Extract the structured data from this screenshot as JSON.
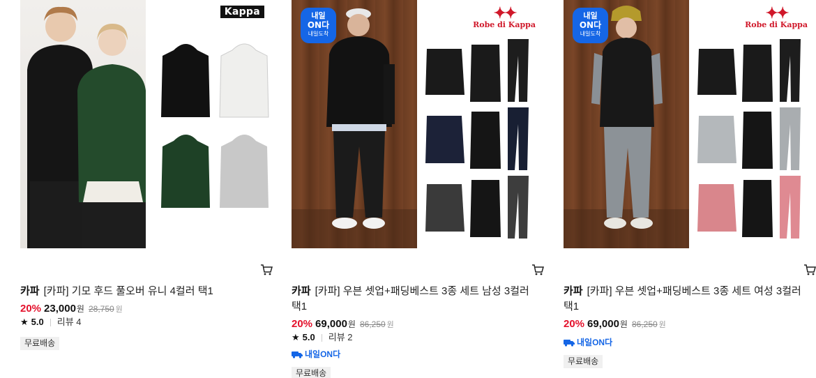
{
  "products": [
    {
      "brand": "카파",
      "name": "[카파] 기모 후드 풀오버 유니 4컬러 택1",
      "discount": "20%",
      "price": "23,000",
      "currency": "원",
      "original_price": "28,750",
      "rating": "5.0",
      "review": "리뷰 4",
      "shipping": "무료배송",
      "logo": "Kappa",
      "cart_icon": "cart-icon"
    },
    {
      "brand": "카파",
      "name": "[카파] 우븐 셋업+패딩베스트 3종 세트 남성 3컬러 택1",
      "discount": "20%",
      "price": "69,000",
      "currency": "원",
      "original_price": "86,250",
      "rating": "5.0",
      "review": "리뷰 2",
      "tomorrow_badge": "내일ON다",
      "shipping": "무료배송",
      "logo": "Robe di Kappa",
      "flag": {
        "line1": "내일",
        "line2": "ON다",
        "line3": "내일도착"
      },
      "cart_icon": "cart-icon"
    },
    {
      "brand": "카파",
      "name": "[카파] 우븐 셋업+패딩베스트 3종 세트 여성 3컬러 택1",
      "discount": "20%",
      "price": "69,000",
      "currency": "원",
      "original_price": "86,250",
      "tomorrow_badge": "내일ON다",
      "shipping": "무료배송",
      "logo": "Robe di Kappa",
      "flag": {
        "line1": "내일",
        "line2": "ON다",
        "line3": "내일도착"
      },
      "cart_icon": "cart-icon"
    }
  ],
  "colors": {
    "accent_red": "#e4112c",
    "accent_blue": "#1566e6"
  }
}
